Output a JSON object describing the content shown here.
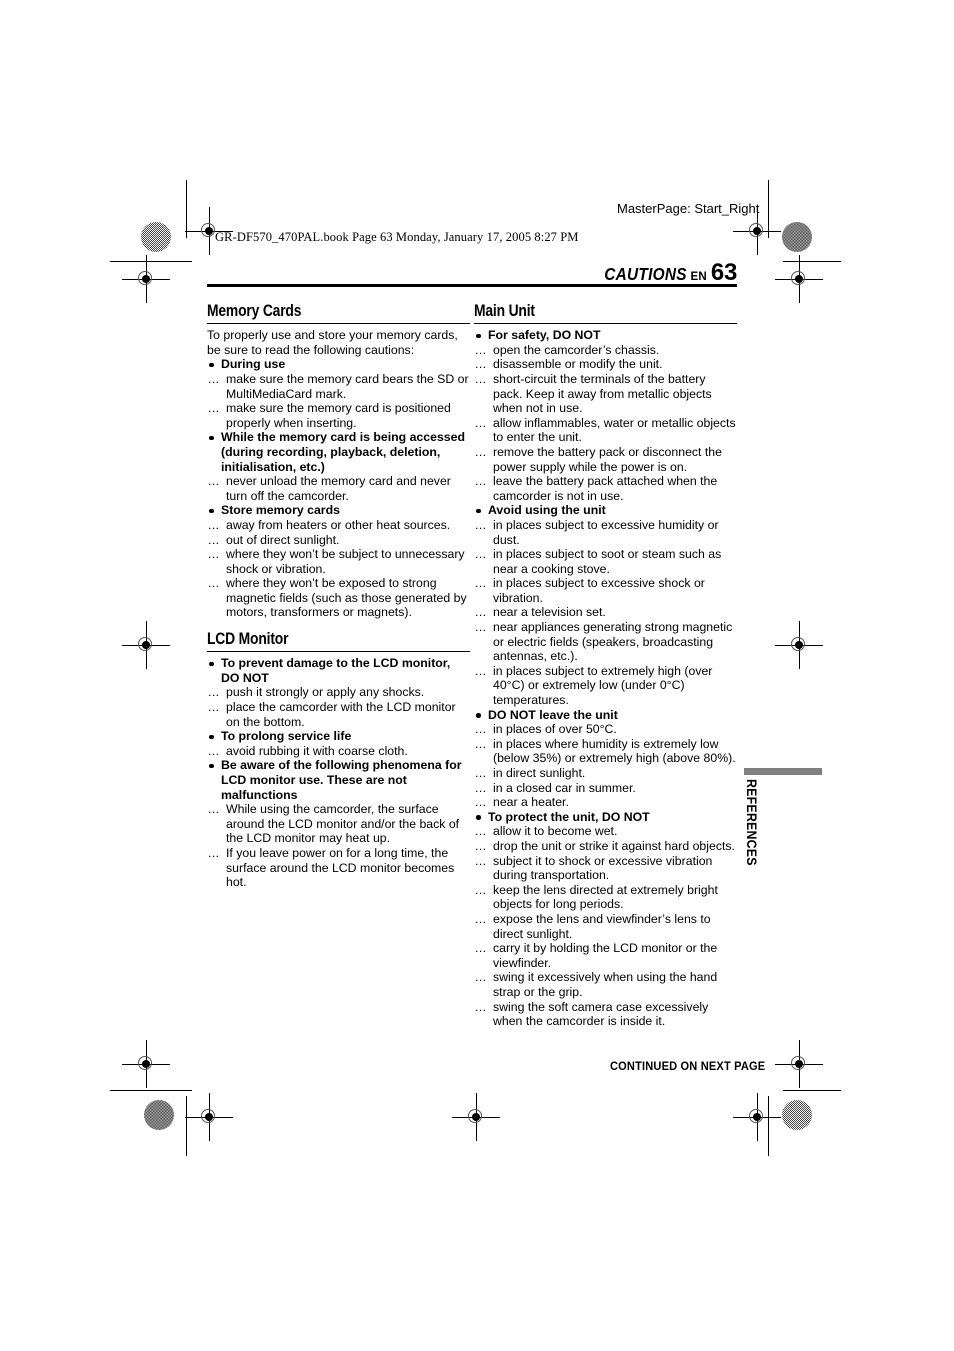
{
  "print_header": {
    "masterpage": "MasterPage: Start_Right",
    "book_line": "GR-DF570_470PAL.book  Page 63  Monday, January 17, 2005  8:27 PM"
  },
  "page_head": {
    "section_name": "CAUTIONS",
    "lang_code": "EN",
    "page_number": "63"
  },
  "side_tab": {
    "label": "REFERENCES"
  },
  "footer": {
    "continued": "CONTINUED ON NEXT PAGE"
  },
  "colors": {
    "ink": "#000000",
    "tab_gray": "#808080",
    "regmark_ring": "#555555"
  },
  "columns": {
    "left": [
      {
        "heading": "Memory Cards",
        "intro": "To properly use and store your memory cards, be sure to read the following cautions:",
        "items": [
          {
            "type": "bullet",
            "text": "During use"
          },
          {
            "type": "dots",
            "text": "make sure the memory card bears the SD or MultiMediaCard mark."
          },
          {
            "type": "dots",
            "text": "make sure the memory card is positioned properly when inserting."
          },
          {
            "type": "bullet",
            "text": "While the memory card is being accessed (during recording, playback, deletion, initialisation, etc.)"
          },
          {
            "type": "dots",
            "text": "never unload the memory card and never turn off the camcorder."
          },
          {
            "type": "bullet",
            "text": "Store memory cards"
          },
          {
            "type": "dots",
            "text": "away from heaters or other heat sources."
          },
          {
            "type": "dots",
            "text": "out of direct sunlight."
          },
          {
            "type": "dots",
            "text": "where they won’t be subject to unnecessary shock or vibration."
          },
          {
            "type": "dots",
            "text": "where they won’t be exposed to strong magnetic fields (such as those generated by motors, transformers or magnets)."
          }
        ]
      },
      {
        "heading": "LCD Monitor",
        "intro": "",
        "items": [
          {
            "type": "bullet",
            "text": "To prevent damage to the LCD monitor, DO NOT"
          },
          {
            "type": "dots",
            "text": "push it strongly or apply any shocks."
          },
          {
            "type": "dots",
            "text": "place the camcorder with the LCD monitor on the bottom."
          },
          {
            "type": "bullet",
            "text": "To prolong service life"
          },
          {
            "type": "dots",
            "text": "avoid rubbing it with coarse cloth."
          },
          {
            "type": "bullet",
            "text": "Be aware of the following phenomena for LCD monitor use. These are not malfunctions"
          },
          {
            "type": "dots",
            "text": "While using the camcorder, the surface around the LCD monitor and/or the back of the LCD monitor may heat up."
          },
          {
            "type": "dots",
            "text": "If you leave power on for a long time, the surface around the LCD monitor becomes hot."
          }
        ]
      }
    ],
    "right": [
      {
        "heading": "Main Unit",
        "intro": "",
        "items": [
          {
            "type": "bullet",
            "text": "For safety, DO NOT"
          },
          {
            "type": "dots",
            "text": "open the camcorder’s chassis."
          },
          {
            "type": "dots",
            "text": "disassemble or modify the unit."
          },
          {
            "type": "dots",
            "text": "short-circuit the terminals of the battery pack. Keep it away from metallic objects when not in use."
          },
          {
            "type": "dots",
            "text": "allow inflammables, water or metallic objects to enter the unit."
          },
          {
            "type": "dots",
            "text": "remove the battery pack or disconnect the power supply while the power is on."
          },
          {
            "type": "dots",
            "text": "leave the battery pack attached when the camcorder is not in use."
          },
          {
            "type": "bullet",
            "text": "Avoid using the unit"
          },
          {
            "type": "dots",
            "text": "in places subject to excessive humidity or dust."
          },
          {
            "type": "dots",
            "text": "in places subject to soot or steam such as near a cooking stove."
          },
          {
            "type": "dots",
            "text": "in places subject to excessive shock or vibration."
          },
          {
            "type": "dots",
            "text": "near a television set."
          },
          {
            "type": "dots",
            "text": "near appliances generating strong magnetic or electric fields (speakers, broadcasting antennas, etc.)."
          },
          {
            "type": "dots",
            "text": "in places subject to extremely high (over 40°C) or extremely low (under 0°C) temperatures."
          },
          {
            "type": "bullet",
            "text": "DO NOT leave the unit"
          },
          {
            "type": "dots",
            "text": "in places of over 50°C."
          },
          {
            "type": "dots",
            "text": "in places where humidity is extremely low (below 35%) or extremely high (above 80%)."
          },
          {
            "type": "dots",
            "text": "in direct sunlight."
          },
          {
            "type": "dots",
            "text": "in a closed car in summer."
          },
          {
            "type": "dots",
            "text": "near a heater."
          },
          {
            "type": "bullet",
            "text": "To protect the unit, DO NOT"
          },
          {
            "type": "dots",
            "text": "allow it to become wet."
          },
          {
            "type": "dots",
            "text": "drop the unit or strike it against hard objects."
          },
          {
            "type": "dots",
            "text": "subject it to shock or excessive vibration during transportation."
          },
          {
            "type": "dots",
            "text": "keep the lens directed at extremely bright objects for long periods."
          },
          {
            "type": "dots",
            "text": "expose the lens and viewfinder’s lens to direct sunlight."
          },
          {
            "type": "dots",
            "text": "carry it by holding the LCD monitor or the viewfinder."
          },
          {
            "type": "dots",
            "text": "swing it excessively when using the hand strap or the grip."
          },
          {
            "type": "dots",
            "text": "swing the soft camera case excessively when the camcorder is inside it."
          }
        ]
      }
    ]
  },
  "lead_marker": "..."
}
